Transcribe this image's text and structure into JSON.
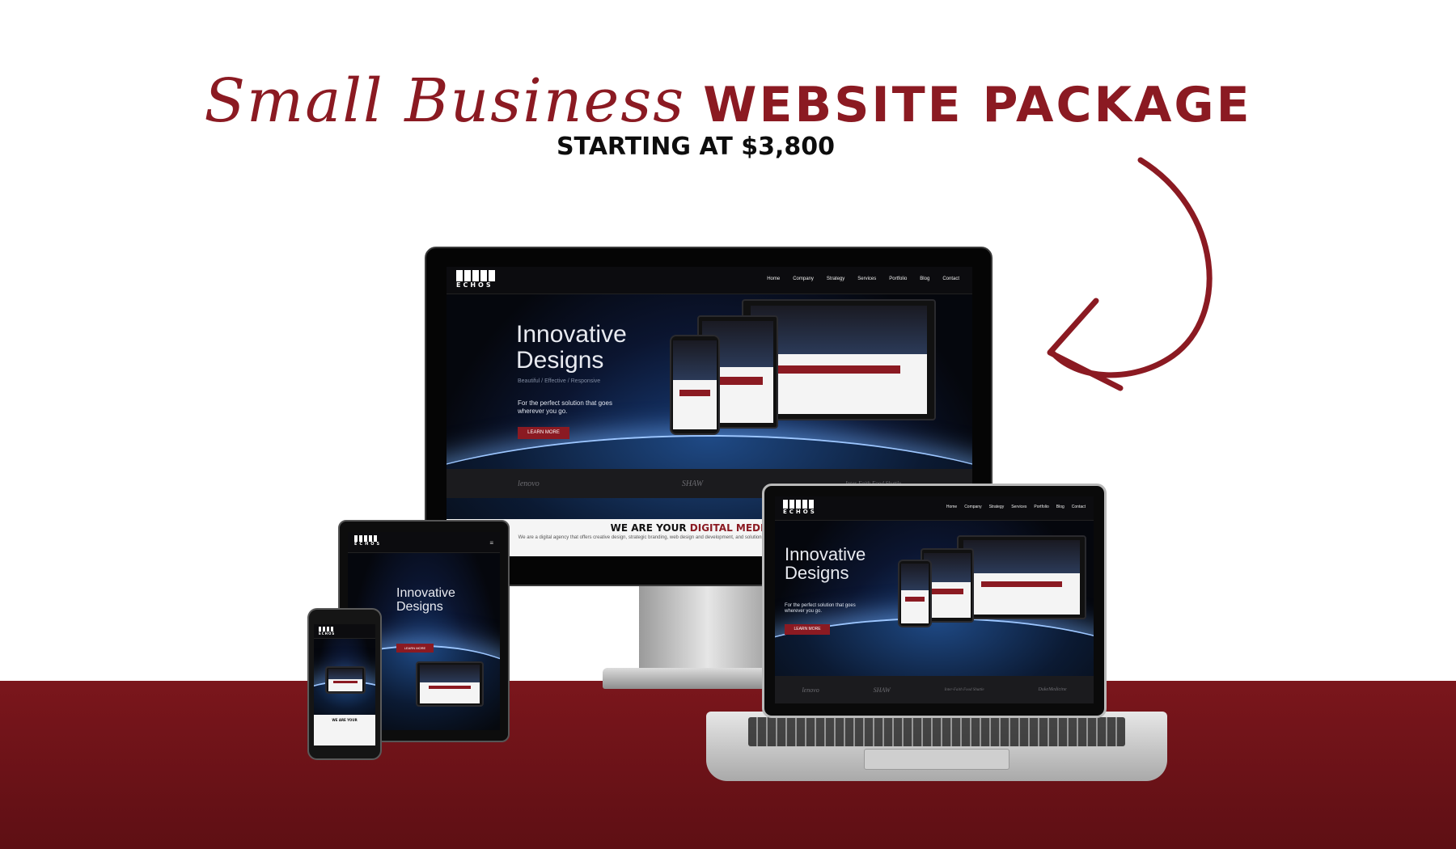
{
  "headline": {
    "script_text": "Small Business",
    "bold_text": "WEBSITE PACKAGE",
    "subtitle": "STARTING AT $3,800"
  },
  "colors": {
    "accent": "#8b1a22",
    "floor": "#6c1218"
  },
  "icons": {
    "arrow": "hand-drawn-curved-arrow-icon"
  },
  "site": {
    "logo_text": "ECHOS",
    "nav": [
      "Home",
      "Company",
      "Strategy",
      "Services",
      "Portfolio",
      "Blog",
      "Contact"
    ],
    "hero_title_line1": "Innovative",
    "hero_title_line2": "Designs",
    "hero_subtitle": "Beautiful / Effective / Responsive",
    "hero_desc_line1": "For the perfect solution that goes",
    "hero_desc_line2": "wherever you go.",
    "cta": "LEARN MORE",
    "clients": [
      "lenovo",
      "SHAW",
      "Inter-Faith Food Shuttle",
      "DukeMedicine"
    ],
    "section_title_a": "WE ARE YOUR ",
    "section_title_b": "DIGITAL MEDIA & DES",
    "section_text": "We are a digital agency that offers creative design, strategic branding, web design and development, and solutions from strategy and design to marketing, with ROI as our primary"
  }
}
